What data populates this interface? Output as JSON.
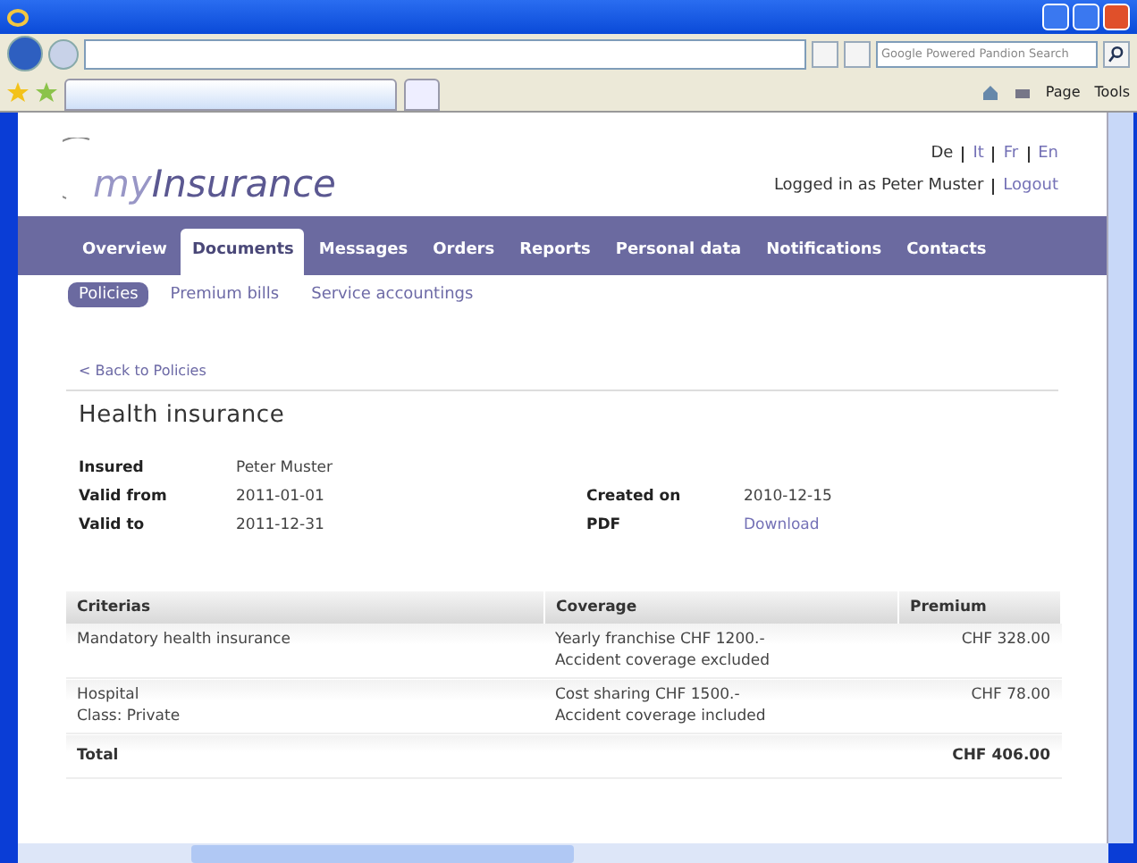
{
  "browser": {
    "search_placeholder": "Google Powered Pandion Search",
    "toolbar": [
      {
        "label": "Page"
      },
      {
        "label": "Tools"
      }
    ]
  },
  "logo": {
    "prefix": "my",
    "name": "Insurance"
  },
  "languages": [
    {
      "label": "De",
      "selected": true
    },
    {
      "label": "It",
      "selected": false
    },
    {
      "label": "Fr",
      "selected": false
    },
    {
      "label": "En",
      "selected": false
    }
  ],
  "user": {
    "logged_in": "Logged in as Peter Muster",
    "logout": "Logout"
  },
  "tabs": [
    {
      "label": "Overview",
      "selected": false
    },
    {
      "label": "Documents",
      "selected": true
    },
    {
      "label": "Messages",
      "selected": false
    },
    {
      "label": "Orders",
      "selected": false
    },
    {
      "label": "Reports",
      "selected": false
    },
    {
      "label": "Personal data",
      "selected": false
    },
    {
      "label": "Notifications",
      "selected": false
    },
    {
      "label": "Contacts",
      "selected": false
    }
  ],
  "subtabs": [
    {
      "label": "Policies",
      "selected": true
    },
    {
      "label": "Premium bills",
      "selected": false
    },
    {
      "label": "Service accountings",
      "selected": false
    }
  ],
  "back_link": "< Back to Policies",
  "heading": "Health insurance",
  "details": [
    {
      "label": "Insured",
      "value": "Peter Muster"
    },
    {
      "label": "Valid from",
      "value": "2011-01-01",
      "label2": "Created on",
      "value2": "2010-12-15"
    },
    {
      "label": "Valid to",
      "value": "2011-12-31",
      "label2": "PDF",
      "link2": "Download"
    }
  ],
  "table": {
    "columns": [
      "Criterias",
      "Coverage",
      "Premium"
    ],
    "rows": [
      {
        "criteria": [
          "Mandatory health insurance"
        ],
        "coverage": [
          "Yearly franchise CHF 1200.-",
          "Accident coverage excluded"
        ],
        "premium": "CHF 328.00"
      },
      {
        "criteria": [
          "Hospital",
          "Class: Private"
        ],
        "coverage": [
          "Cost sharing CHF 1500.-",
          "Accident coverage included"
        ],
        "premium": "CHF 78.00"
      }
    ],
    "total": {
      "label": "Total",
      "premium": "CHF 406.00"
    }
  }
}
